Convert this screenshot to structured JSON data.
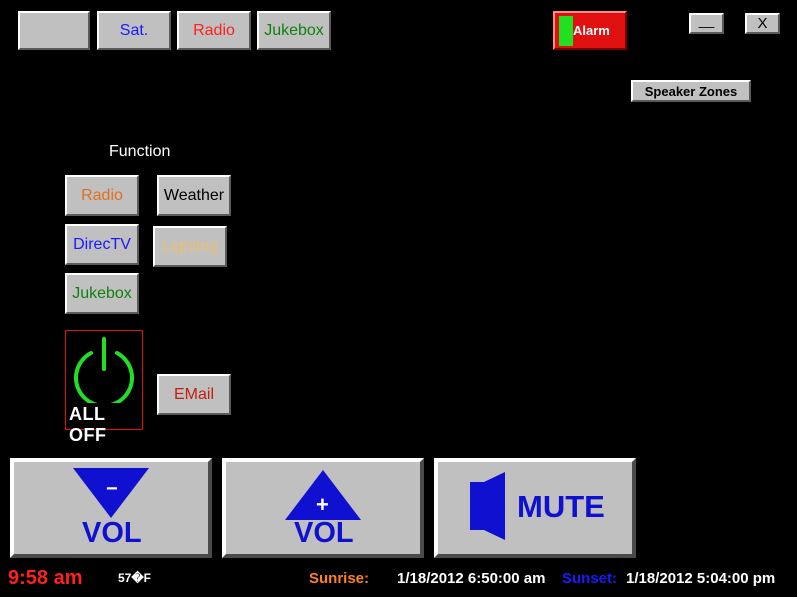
{
  "top_bar": {
    "blank_button": "",
    "sat_label": "Sat.",
    "radio_label": "Radio",
    "jukebox_label": "Jukebox",
    "alarm_label": "Alarm",
    "minimize_label": "__",
    "close_label": "X"
  },
  "speaker_zones_label": "Speaker Zones",
  "function": {
    "heading": "Function",
    "radio_label": "Radio",
    "weather_label": "Weather",
    "directv_label": "DirecTV",
    "lighting_label": "Lighting",
    "jukebox_label": "Jukebox",
    "all_off_label": "ALL OFF",
    "email_label": "EMail"
  },
  "controls": {
    "vol_down_label": "VOL",
    "vol_down_sign": "−",
    "vol_up_label": "VOL",
    "vol_up_sign": "+",
    "mute_label": "MUTE"
  },
  "status": {
    "time": "9:58 am",
    "temperature": "57�F",
    "sunrise_label": "Sunrise:",
    "sunrise_value": "1/18/2012 6:50:00 am",
    "sunset_label": "Sunset:",
    "sunset_value": "1/18/2012 5:04:00 pm"
  },
  "colors": {
    "background": "#000000",
    "button_face": "#c0c0c0",
    "sat_text": "#1a1aff",
    "radio_text": "#ff2020",
    "jukebox_text": "#108010",
    "alarm_bg": "#e01010",
    "alarm_indicator": "#20e020",
    "function_radio_text": "#e07020",
    "directv_text": "#1a1aff",
    "lighting_text": "#e8c070",
    "email_text": "#c02010",
    "power_icon": "#20e020",
    "vol_blue": "#1010d0",
    "time_text": "#ff2020",
    "sunrise_label": "#ff8020",
    "sunset_label": "#1a1aff"
  }
}
